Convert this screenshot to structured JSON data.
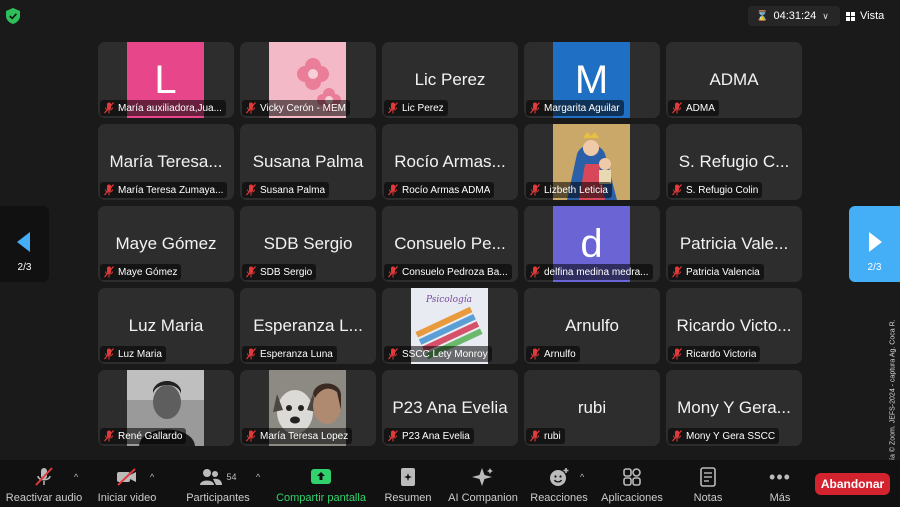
{
  "topbar": {
    "timer": "04:31:24",
    "view_label": "Vista"
  },
  "navigation": {
    "left_page": "2/3",
    "right_page": "2/3"
  },
  "tiles": [
    {
      "display": "",
      "avatar_letter": "L",
      "avatar_color": "#e8468a",
      "name": "María auxiliadora,Jua..."
    },
    {
      "display": "",
      "avatar_image": "pink-flowers",
      "name": "Vicky Cerón - MEM"
    },
    {
      "display": "Lic Perez",
      "name": "Lic Perez"
    },
    {
      "display": "",
      "avatar_letter": "M",
      "avatar_color": "#1f6fc4",
      "name": "Margarita Aguilar"
    },
    {
      "display": "ADMA",
      "name": "ADMA"
    },
    {
      "display": "María Teresa...",
      "name": "María Teresa Zumaya..."
    },
    {
      "display": "Susana Palma",
      "name": "Susana Palma"
    },
    {
      "display": "Rocío Armas...",
      "name": "Rocío Armas ADMA"
    },
    {
      "display": "",
      "avatar_image": "virgin-mary",
      "name": "Lizbeth Leticia"
    },
    {
      "display": "S. Refugio C...",
      "name": "S. Refugio Colin"
    },
    {
      "display": "Maye Gómez",
      "name": "Maye Gómez"
    },
    {
      "display": "SDB Sergio",
      "name": "SDB Sergio"
    },
    {
      "display": "Consuelo Pe...",
      "name": "Consuelo Pedroza Ba..."
    },
    {
      "display": "",
      "avatar_letter": "d",
      "avatar_color": "#6a64d4",
      "name": "delfina medina medra..."
    },
    {
      "display": "Patricia Vale...",
      "name": "Patricia Valencia"
    },
    {
      "display": "Luz Maria",
      "name": "Luz Maria"
    },
    {
      "display": "Esperanza L...",
      "name": "Esperanza Luna"
    },
    {
      "display": "",
      "avatar_image": "psicologia-pencils",
      "name": "SSCC Lety Monroy"
    },
    {
      "display": "Arnulfo",
      "name": "Arnulfo"
    },
    {
      "display": "Ricardo Victo...",
      "name": "Ricardo Victoria"
    },
    {
      "display": "",
      "avatar_image": "man-portrait-bw",
      "name": "René Gallardo"
    },
    {
      "display": "",
      "avatar_image": "dog-selfie",
      "name": "María Teresa Lopez"
    },
    {
      "display": "P23 Ana Evelia",
      "name": "P23 Ana Evelia"
    },
    {
      "display": "rubi",
      "name": "rubi"
    },
    {
      "display": "Mony Y Gera...",
      "name": "Mony Y Gera SSCC"
    }
  ],
  "toolbar": {
    "audio": "Reactivar audio",
    "video": "Iniciar video",
    "participants": "Participantes",
    "participants_count": "54",
    "share": "Compartir pantalla",
    "summary": "Resumen",
    "ai": "AI Companion",
    "reactions": "Reacciones",
    "apps": "Aplicaciones",
    "notes": "Notas",
    "more": "Más",
    "leave": "Abandonar"
  },
  "watermark": "Cortesía © Zoom. JEFS-2024 - captura Ag. Coca R.",
  "colors": {
    "accent": "#44aef7",
    "share_green": "#31d26e",
    "leave_red": "#d3232f",
    "muted_red": "#e23a3a"
  }
}
